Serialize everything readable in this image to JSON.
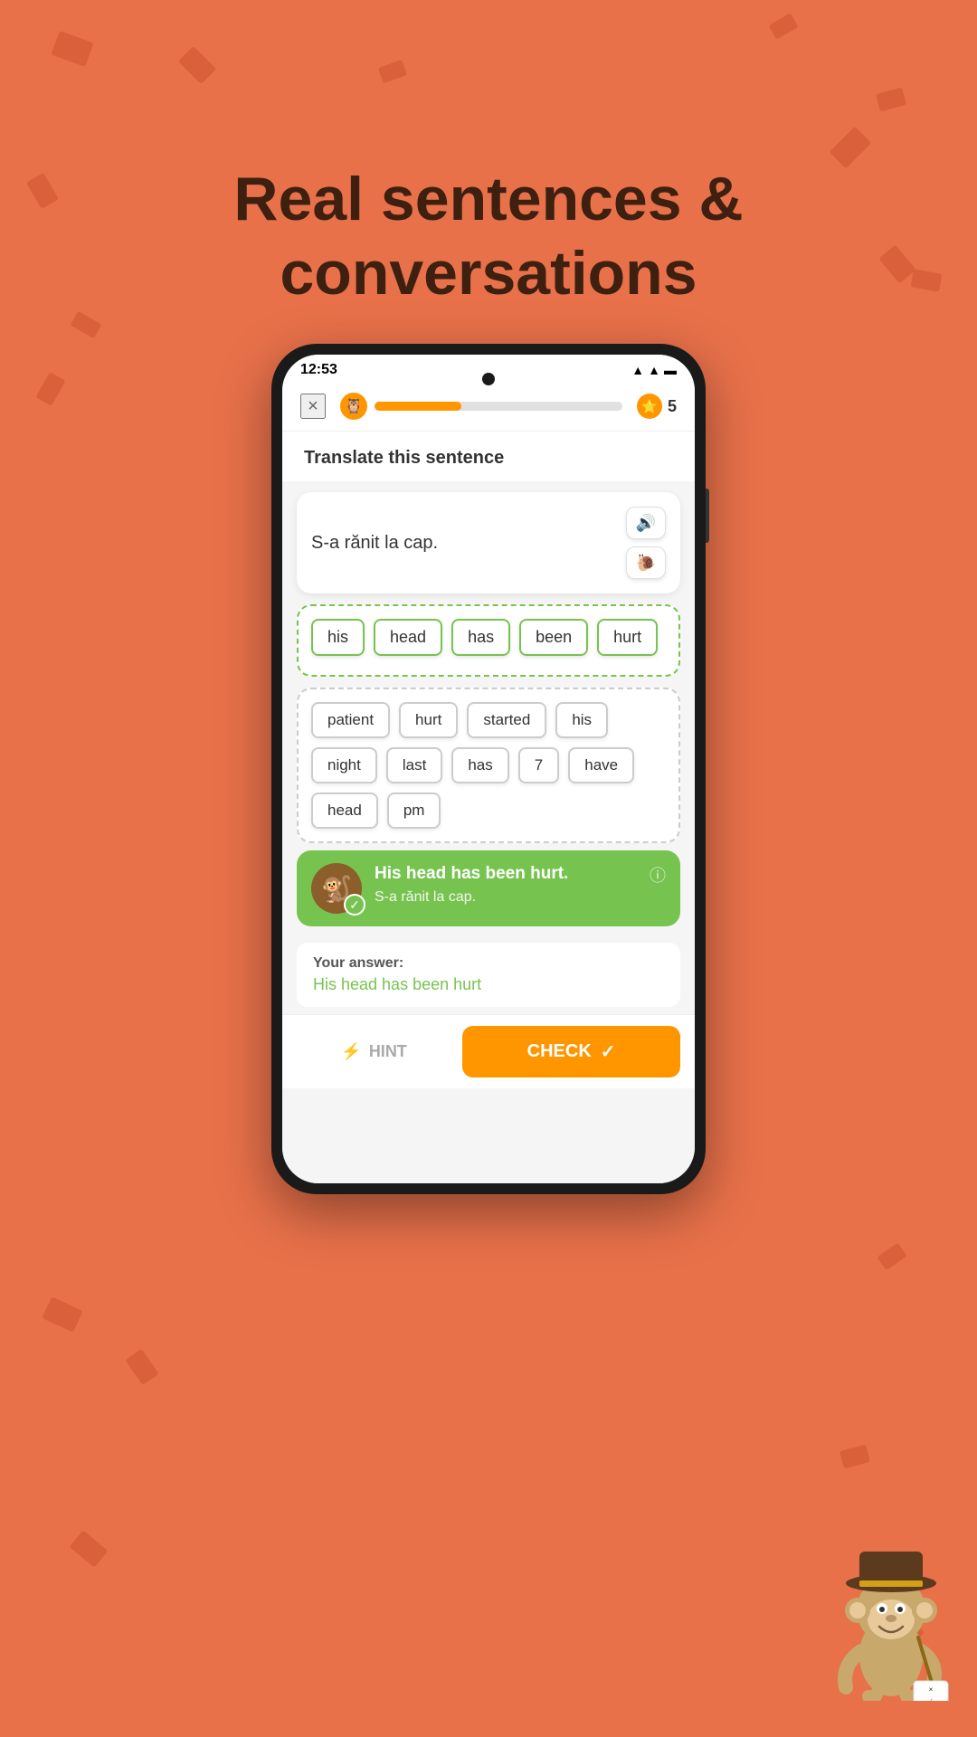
{
  "page": {
    "background_color": "#E8714A",
    "title_line1": "Real sentences &",
    "title_line2": "conversations"
  },
  "status_bar": {
    "time": "12:53",
    "icons": "▲ ◄ ■"
  },
  "top_bar": {
    "close_label": "×",
    "progress_percent": 35,
    "coin_icon": "⭐",
    "coin_count": "5"
  },
  "exercise": {
    "instruction": "Translate this sentence",
    "sentence": "S-a rănit la cap.",
    "audio_icon": "🔊",
    "slow_audio_icon": "🐌"
  },
  "selected_words": [
    "his",
    "head",
    "has",
    "been",
    "hurt"
  ],
  "word_bank": [
    "patient",
    "hurt",
    "started",
    "his",
    "night",
    "last",
    "has",
    "7",
    "have",
    "head",
    "pm"
  ],
  "result": {
    "correct_answer": "His head has been hurt.",
    "translation": "S-a rănit la cap.",
    "info_icon": "ⓘ",
    "check_badge": "✓"
  },
  "your_answer": {
    "label": "Your answer:",
    "text": "His head has been hurt"
  },
  "buttons": {
    "hint_icon": "⚡",
    "hint_label": "HINT",
    "check_label": "CHECK",
    "check_icon": "✓"
  }
}
